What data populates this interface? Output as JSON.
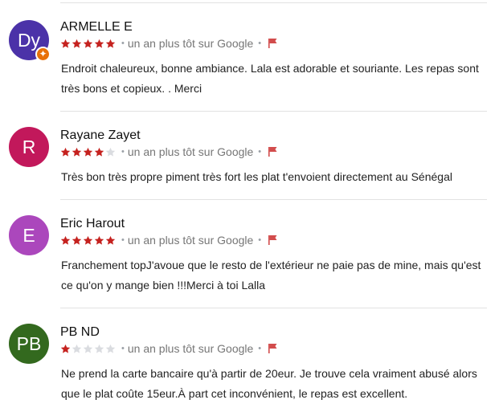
{
  "reviews": [
    {
      "initials": "Dy",
      "avatar_color": "#4b32a8",
      "local_guide_badge": "✦",
      "name": "ARMELLE E",
      "rating": 5,
      "dot": "•",
      "time": "un an plus tôt sur Google",
      "text": "Endroit chaleureux, bonne ambiance. Lala est adorable et souriante. Les repas sont très bons et copieux. . Merci"
    },
    {
      "initials": "R",
      "avatar_color": "#c2185b",
      "name": "Rayane Zayet",
      "rating": 4,
      "dot": "•",
      "time": "un an plus tôt sur Google",
      "text": "Très bon très propre piment très fort les plat t'envoient directement au Sénégal"
    },
    {
      "initials": "E",
      "avatar_color": "#ab47bc",
      "name": "Eric Harout",
      "rating": 5,
      "dot": "•",
      "time": "un an plus tôt sur Google",
      "text": "Franchement topJ'avoue que le resto de l'extérieur ne paie pas de mine, mais qu'est ce qu'on y mange bien !!!Merci à toi Lalla"
    },
    {
      "initials": "PB",
      "avatar_color": "#33691e",
      "name": "PB ND",
      "rating": 1,
      "dot": "•",
      "time": "un an plus tôt sur Google",
      "text": "Ne prend la carte bancaire qu'à partir de 20eur. Je trouve cela vraiment abusé alors que le plat coûte 15eur.À part cet inconvénient, le repas est excellent."
    }
  ],
  "max_rating": 5,
  "colors": {
    "star_full": "#c5221f",
    "star_empty": "#dadce0",
    "flag": "#d24c4c"
  },
  "icons": {
    "star": "star-icon",
    "flag": "report-flag-icon",
    "badge": "local-guide-badge-icon"
  }
}
